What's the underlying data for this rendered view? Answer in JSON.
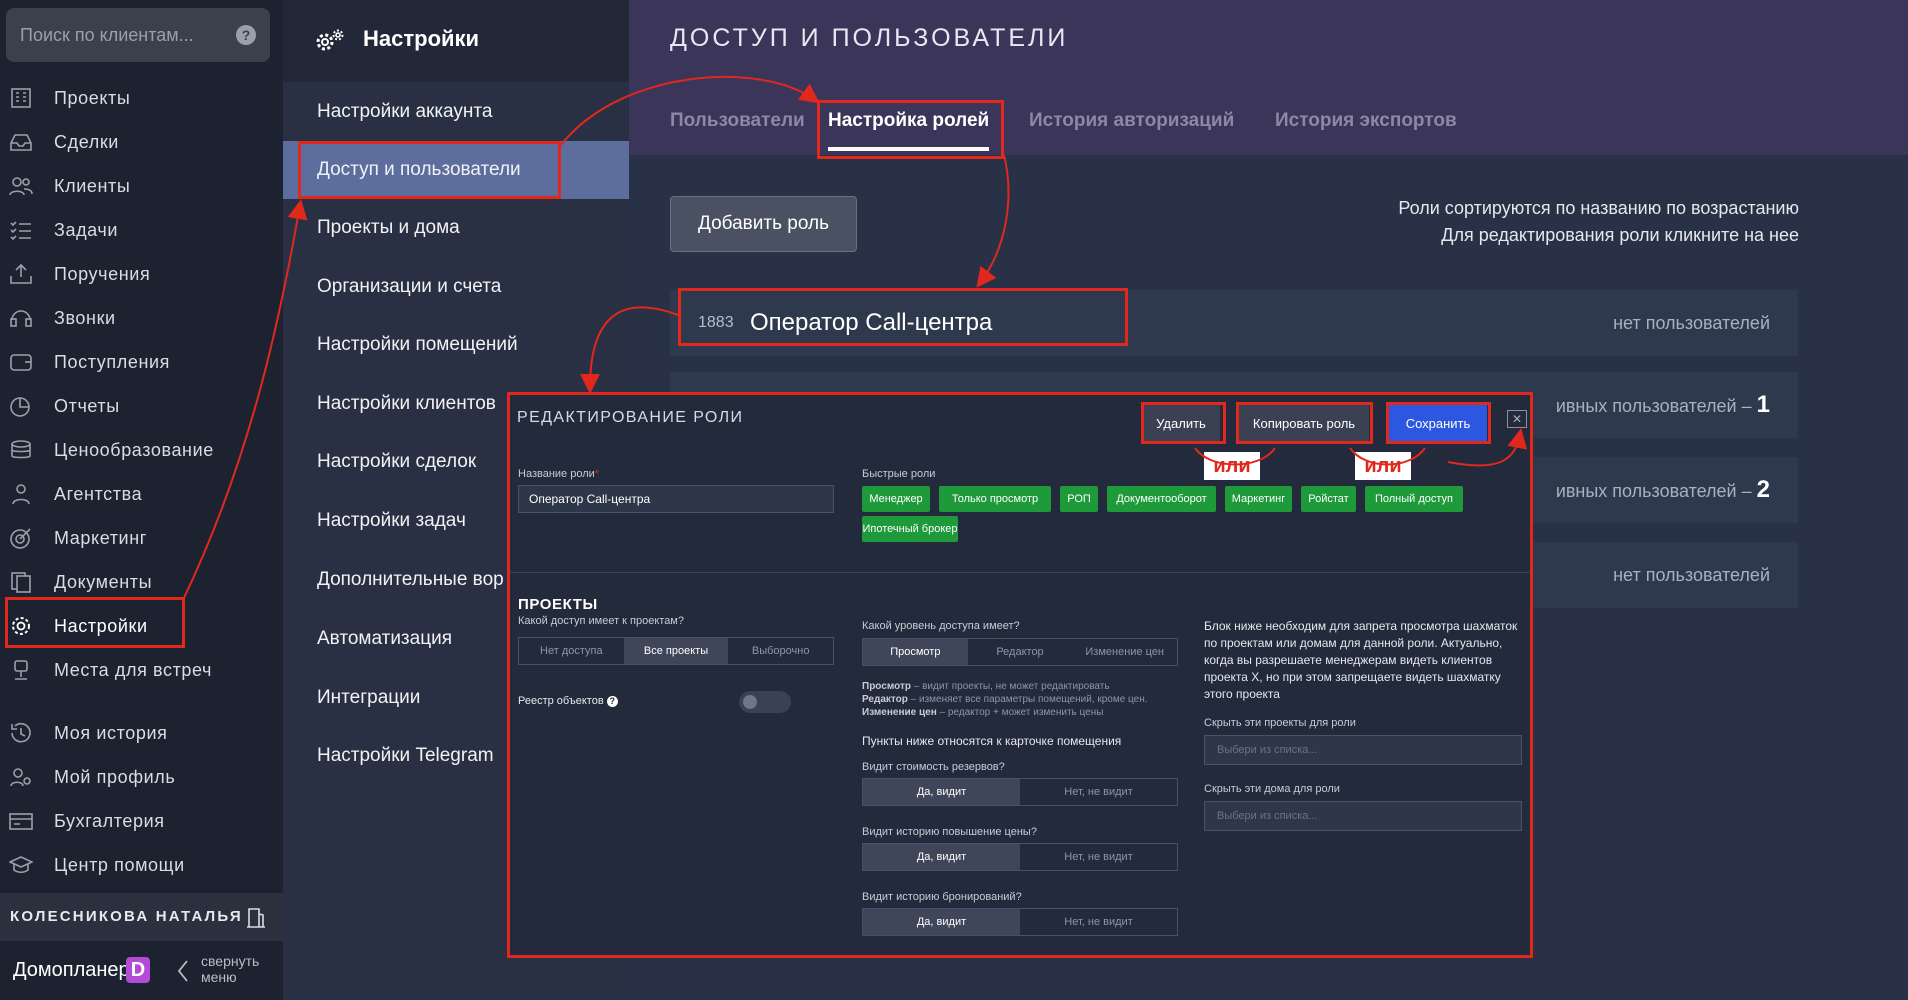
{
  "search": {
    "placeholder": "Поиск по клиентам...",
    "help": "?"
  },
  "nav": {
    "items": [
      {
        "label": "Проекты",
        "icon": "building-icon"
      },
      {
        "label": "Сделки",
        "icon": "inbox-icon"
      },
      {
        "label": "Клиенты",
        "icon": "users-icon"
      },
      {
        "label": "Задачи",
        "icon": "list-icon"
      },
      {
        "label": "Поручения",
        "icon": "upload-icon"
      },
      {
        "label": "Звонки",
        "icon": "headset-icon"
      },
      {
        "label": "Поступления",
        "icon": "wallet-icon"
      },
      {
        "label": "Отчеты",
        "icon": "pie-chart-icon"
      },
      {
        "label": "Ценообразование",
        "icon": "coins-icon"
      },
      {
        "label": "Агентства",
        "icon": "agent-icon"
      },
      {
        "label": "Маркетинг",
        "icon": "target-icon"
      },
      {
        "label": "Документы",
        "icon": "documents-icon"
      },
      {
        "label": "Настройки",
        "icon": "gear-icon"
      },
      {
        "label": "Места для встреч",
        "icon": "meeting-icon"
      },
      {
        "label": "Моя история",
        "icon": "history-icon"
      },
      {
        "label": "Мой профиль",
        "icon": "profile-icon"
      },
      {
        "label": "Бухгалтерия",
        "icon": "accounting-icon"
      },
      {
        "label": "Центр помощи",
        "icon": "graduation-cap-icon"
      }
    ],
    "active": "Настройки"
  },
  "user": {
    "name": "КОЛЕСНИКОВА НАТАЛЬЯ"
  },
  "brand": {
    "name": "Домопланер",
    "logo_letter": "D",
    "collapse": "свернуть меню",
    "logo_color": "#b34bd6"
  },
  "settings": {
    "title": "Настройки",
    "items": [
      "Настройки аккаунта",
      "Доступ и пользователи",
      "Проекты и дома",
      "Организации и счета",
      "Настройки помещений",
      "Настройки клиентов",
      "Настройки сделок",
      "Настройки задач",
      "Дополнительные вор",
      "Автоматизация",
      "Интеграции",
      "Настройки Telegram"
    ],
    "active": "Доступ и пользователи"
  },
  "main": {
    "title": "ДОСТУП И ПОЛЬЗОВАТЕЛИ",
    "tabs": [
      "Пользователи",
      "Настройка ролей",
      "История авторизаций",
      "История экспортов"
    ],
    "active_tab": "Настройка ролей",
    "add_role": "Добавить роль",
    "hint_1": "Роли сортируются по названию по возрастанию",
    "hint_2": "Для редактирования роли кликните на нее",
    "roles": [
      {
        "id": "1883",
        "name": "Оператор Call-центра",
        "users": "нет пользователей"
      },
      {
        "users_prefix": "ивных пользователей –",
        "count": "1"
      },
      {
        "users_prefix": "ивных пользователей –",
        "count": "2"
      },
      {
        "users": "нет пользователей"
      }
    ]
  },
  "modal": {
    "title": "РЕДАКТИРОВАНИЕ РОЛИ",
    "delete": "Удалить",
    "copy": "Копировать роль",
    "save": "Сохранить",
    "close": "✕",
    "role_name_label": "Название роли",
    "role_name_required": "*",
    "role_name_value": "Оператор Call-центра",
    "quick_roles_label": "Быстрые роли",
    "quick_roles": [
      "Менеджер",
      "Только просмотр",
      "РОП",
      "Документооборот",
      "Маркетинг",
      "Ройстат",
      "Полный доступ",
      "Ипотечный брокер"
    ],
    "projects_section": "ПРОЕКТЫ",
    "projects_access_q": "Какой доступ имеет к проектам?",
    "projects_access_opts": [
      "Нет доступа",
      "Все проекты",
      "Выборочно"
    ],
    "projects_access_selected": 1,
    "registry_label": "Реестр объектов",
    "registry_help": "?",
    "level_q": "Какой уровень доступа имеет?",
    "level_opts": [
      "Просмотр",
      "Редактор",
      "Изменение цен"
    ],
    "level_selected": 0,
    "level_desc": [
      {
        "term": "Просмотр",
        "text": " – видит проекты, не может редактировать"
      },
      {
        "term": "Редактор",
        "text": " – изменяет все параметры помещений, кроме цен."
      },
      {
        "term": "Изменение цен",
        "text": " – редактор + может изменить цены"
      }
    ],
    "card_note": "Пункты ниже относятся к карточке помещения",
    "q_reserve": "Видит стоимость резервов?",
    "q_price_history": "Видит историю повышение цены?",
    "q_booking_history": "Видит историю бронирований?",
    "yes": "Да, видит",
    "no": "Нет, не видит",
    "block_note": "Блок ниже необходим для запрета просмотра шахматок по проектам или домам для данной роли. Актуально, когда вы разрешаете менеджерам видеть клиентов проекта X, но при этом запрещаете видеть шахматку этого проекта",
    "hide_projects_label": "Скрыть эти проекты для роли",
    "hide_houses_label": "Скрыть эти дома для роли",
    "select_placeholder": "Выбери из списка..."
  },
  "annotations": {
    "or_1": "или",
    "or_2": "или",
    "color": "#e0281d"
  },
  "colors": {
    "save": "#2c57e0",
    "chip": "#1e9a3a",
    "active_menu": "#5c6d9e",
    "header": "#3a3559"
  }
}
